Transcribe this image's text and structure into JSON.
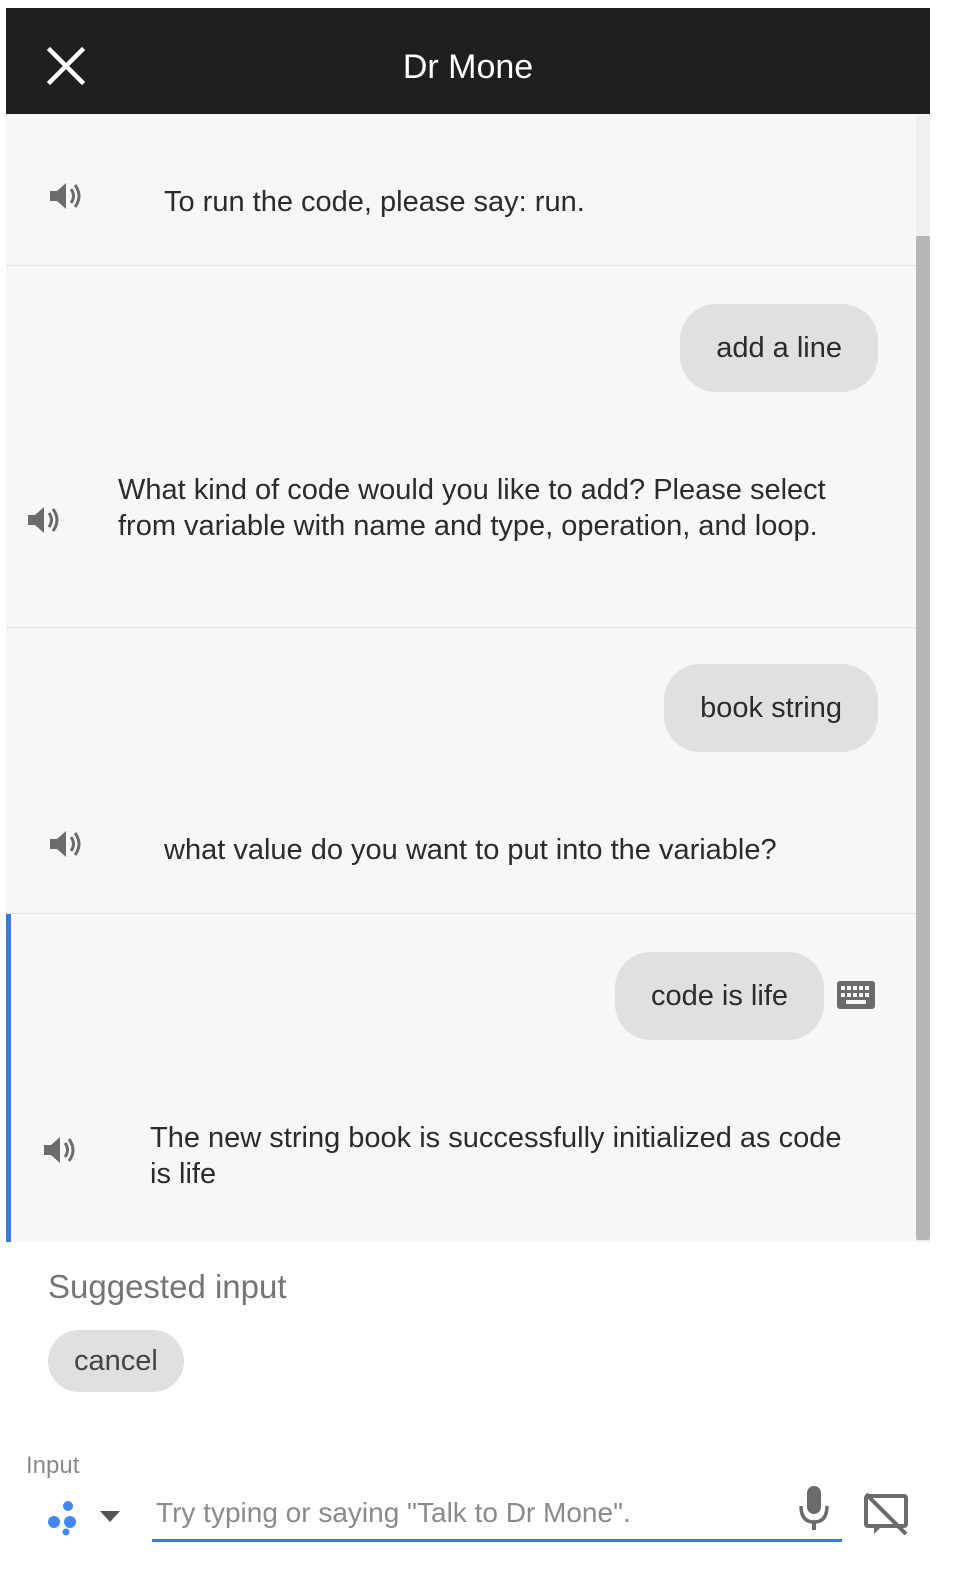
{
  "header": {
    "title": "Dr Mone"
  },
  "conversation": {
    "agent_messages": [
      "To run the code, please say: run.",
      "What kind of code would you like to add? Please select from variable with name and type, operation, and loop.",
      "what value do you want to put into the variable?",
      "The new string book is successfully initialized as code is life"
    ],
    "user_messages": [
      "add a line",
      "book string",
      "code is life"
    ]
  },
  "suggestions": {
    "label": "Suggested input",
    "chips": [
      "cancel"
    ]
  },
  "input": {
    "label": "Input",
    "placeholder": "Try typing or saying \"Talk to Dr Mone\"."
  },
  "colors": {
    "header_bg": "#1f1f1f",
    "accent": "#3b78e7",
    "bubble": "#e0e0e0"
  }
}
